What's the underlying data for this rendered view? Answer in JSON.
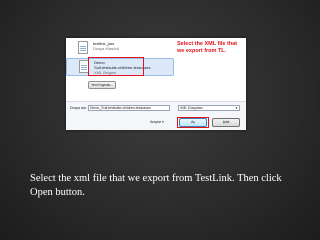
{
  "dialog": {
    "files": [
      {
        "name": "testlink_jars",
        "sub": "Dosya Klasörü"
      },
      {
        "name": "Demo",
        "sub": "Suit.testsuite-children-testcases",
        "type": "XML Belgesi"
      }
    ],
    "callout": "Select the XML file that we export from TL.",
    "new_folder_label": "Yeni Kaynak...",
    "filename_label": "Dosya adı:",
    "filename_value": "Demo_Suit.testsuite-children-testcases",
    "filetype_value": "XML Dosyaları",
    "tools_label": "Araçlar",
    "open_label": "Aç",
    "cancel_label": "İptal"
  },
  "caption": "Select the xml file that we export from TestLink. Then click Open button."
}
